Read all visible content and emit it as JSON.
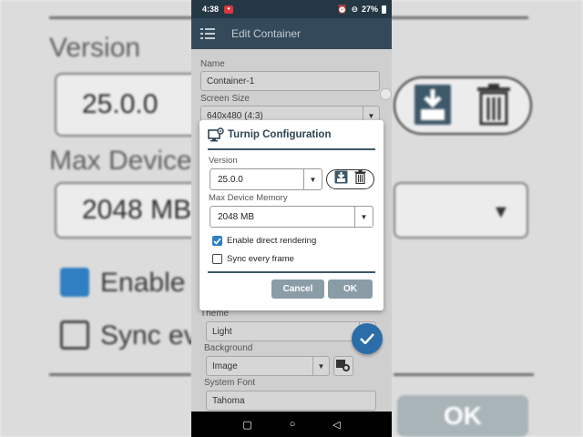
{
  "status_bar": {
    "time": "4:38",
    "battery": "27%"
  },
  "app_bar": {
    "title": "Edit Container"
  },
  "form": {
    "name_label": "Name",
    "name_value": "Container-1",
    "screen_size_label": "Screen Size",
    "screen_size_value": "640x480 (4:3)",
    "theme_label": "Theme",
    "theme_value": "Light",
    "background_label": "Background",
    "background_value": "Image",
    "system_font_label": "System Font",
    "system_font_value": "Tahoma"
  },
  "dialog": {
    "title": "Turnip Configuration",
    "version_label": "Version",
    "version_value": "25.0.0",
    "max_memory_label": "Max Device Memory",
    "max_memory_value": "2048 MB",
    "enable_direct_rendering_label": "Enable direct rendering",
    "enable_direct_rendering_checked": true,
    "sync_every_frame_label": "Sync every frame",
    "sync_every_frame_checked": false,
    "cancel_label": "Cancel",
    "ok_label": "OK"
  },
  "background_zoom": {
    "version_label": "Version",
    "version_value": "25.0.0",
    "max_device_label": "Max Device",
    "memory_value": "2048 MB",
    "enable_text": "Enable",
    "sync_text": "Sync ev",
    "ok_text": "OK"
  },
  "colors": {
    "accent": "#2f7fc2",
    "app_bar": "#34495a",
    "status_bar": "#243744",
    "dialog_title": "#2f4554",
    "dialog_button": "#8a9da6"
  }
}
